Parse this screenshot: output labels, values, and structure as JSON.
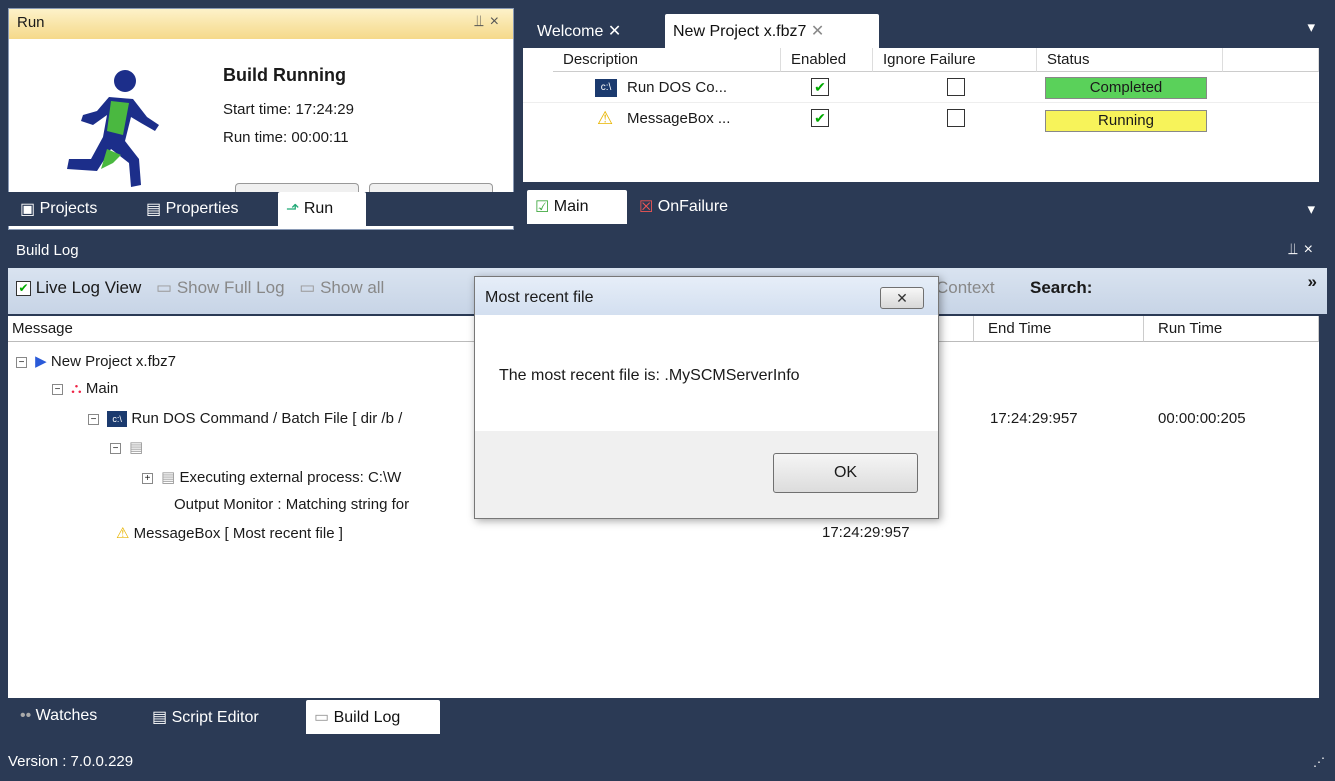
{
  "run_panel": {
    "title": "Run",
    "heading": "Build Running",
    "start_label": "Start time:",
    "start_value": "17:24:29",
    "run_label": "Run time:",
    "run_value": "00:00:11"
  },
  "left_tabs": [
    "Projects",
    "Properties",
    "Run"
  ],
  "doc_tabs": [
    "Welcome",
    "New Project x.fbz7"
  ],
  "grid": {
    "headers": [
      "Description",
      "Enabled",
      "Ignore Failure",
      "Status"
    ],
    "rows": [
      {
        "description": "Run DOS Co...",
        "enabled": true,
        "ignore": false,
        "status": "Completed",
        "status_color": "#5ad15a"
      },
      {
        "description": "MessageBox ...",
        "enabled": true,
        "ignore": false,
        "status": "Running",
        "status_color": "#f7f35a"
      }
    ]
  },
  "sub_tabs": [
    "Main",
    "OnFailure"
  ],
  "build_log": {
    "title": "Build Log",
    "toolbar": {
      "live_log": "Live Log View",
      "full_log": "Show Full Log",
      "show_all": "Show all",
      "context": "Context",
      "search": "Search:"
    },
    "columns": [
      "Message",
      "End Time",
      "Run Time"
    ],
    "rows": [
      {
        "text": "New Project x.fbz7",
        "end": "",
        "run": ""
      },
      {
        "text": "Main",
        "end": "",
        "run": ""
      },
      {
        "text": "Run DOS Command / Batch File [ dir /b /",
        "end": "17:24:29:957",
        "run": "00:00:00:205"
      },
      {
        "text": "",
        "end": "",
        "run": ""
      },
      {
        "text": "Executing external process: C:\\W",
        "end": "",
        "run": ""
      },
      {
        "text": "Output Monitor : Matching string for",
        "end": "",
        "run": ""
      },
      {
        "text": "MessageBox [ Most recent file ]",
        "end": "17:24:29:957",
        "run": ""
      }
    ]
  },
  "dialog": {
    "title": "Most recent file",
    "message": "The most recent file is: .MySCMServerInfo",
    "ok": "OK"
  },
  "bottom_tabs": [
    "Watches",
    "Script Editor",
    "Build Log"
  ],
  "status_bar": {
    "version": "Version :  7.0.0.229"
  },
  "colors": {
    "dark": "#2b3a55",
    "running_yellow": "#f7f35a",
    "completed_green": "#5ad15a"
  }
}
